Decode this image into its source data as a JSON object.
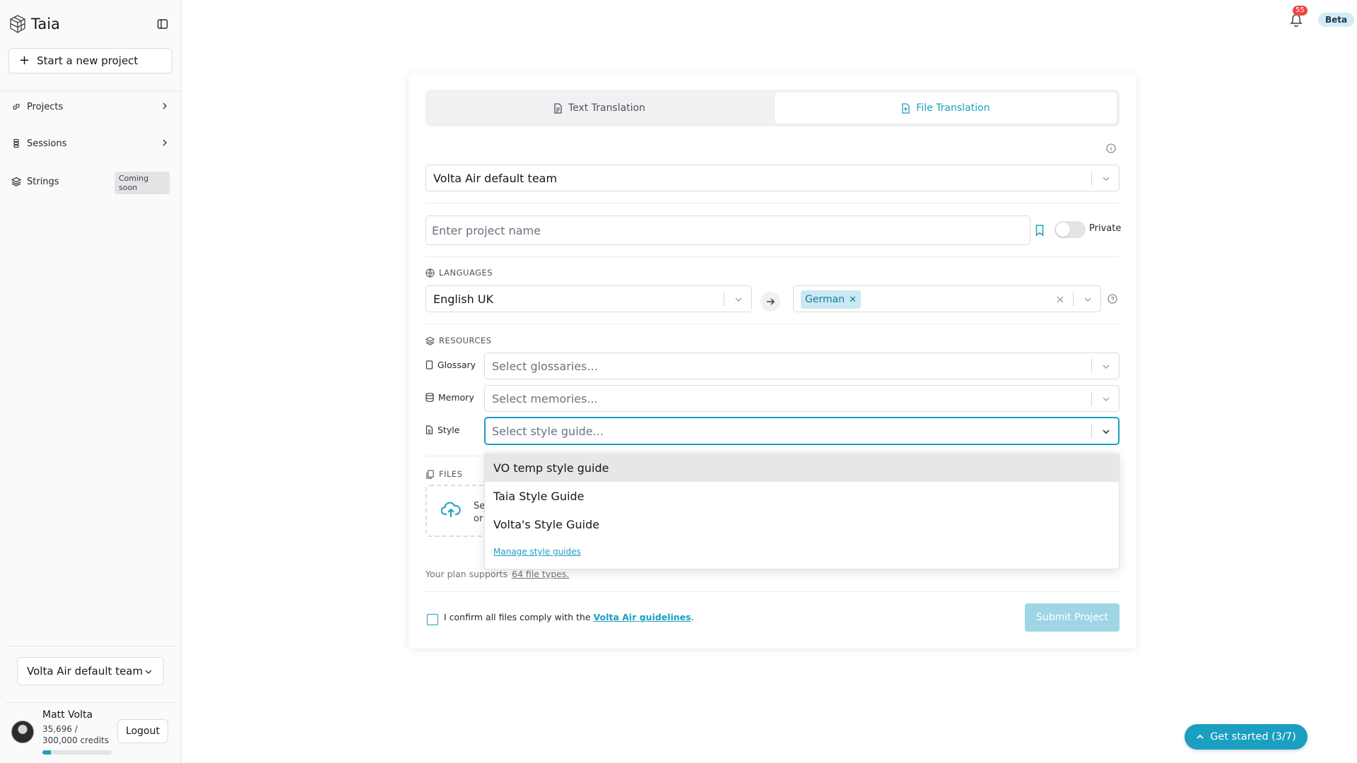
{
  "sidebar": {
    "brand": "Taia",
    "new_project": "Start a new project",
    "items": [
      {
        "label": "Projects"
      },
      {
        "label": "Sessions"
      },
      {
        "label": "Strings",
        "badge": "Coming soon"
      }
    ],
    "team": "Volta Air default team",
    "user": {
      "name": "Matt Volta",
      "credits_line1": "35,696 /",
      "credits_line2": "300,000 credits",
      "credits_used": 35696,
      "credits_total": 300000,
      "logout": "Logout"
    }
  },
  "header": {
    "notifications": "55",
    "beta": "Beta"
  },
  "form": {
    "tabs": [
      {
        "label": "Text Translation",
        "icon": "text-document-icon",
        "active": false
      },
      {
        "label": "File Translation",
        "icon": "file-document-icon",
        "active": true
      }
    ],
    "team_select": "Volta Air default team",
    "project_name_placeholder": "Enter project name",
    "private_label": "Private",
    "languages_label": "LANGUAGES",
    "source_language": "English UK",
    "target_languages": [
      "German"
    ],
    "resources_label": "RESOURCES",
    "glossary": {
      "label": "Glossary",
      "placeholder": "Select glossaries..."
    },
    "memory": {
      "label": "Memory",
      "placeholder": "Select memories..."
    },
    "style": {
      "label": "Style",
      "placeholder": "Select style guide..."
    },
    "files_label": "FILES",
    "upload_line1": "Se",
    "upload_line2": "or",
    "plan_text": "Your plan supports",
    "plan_link": "64 file types.",
    "confirm_text": "I confirm all files comply with the",
    "confirm_link": "Volta Air guidelines",
    "confirm_end": ".",
    "submit": "Submit Project"
  },
  "style_dropdown": {
    "options": [
      "VO temp style guide",
      "Taia Style Guide",
      "Volta's Style Guide"
    ],
    "highlighted": 0,
    "manage": "Manage style guides"
  },
  "get_started": "Get started (3/7)",
  "colors": {
    "accent": "#1a9fc0",
    "notification": "#ef4444"
  }
}
